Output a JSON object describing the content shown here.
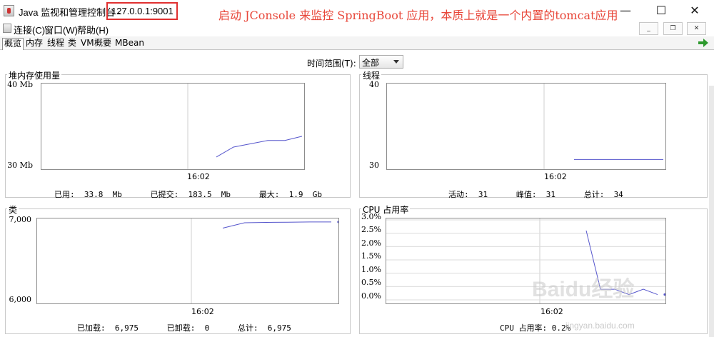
{
  "window": {
    "title": "Java 监视和管理控制台 -",
    "address": "127.0.0.1:9001",
    "annotation": "启动 JConsole 来监控 SpringBoot 应用，本质上就是一个内置的tomcat应用",
    "minimize": "—",
    "maximize": "☐",
    "close": "✕"
  },
  "menu": {
    "items": [
      "连接(C)",
      "窗口(W)",
      "帮助(H)"
    ],
    "mdi_minimize": "_",
    "mdi_restore": "❐",
    "mdi_close": "✕"
  },
  "tabs": [
    "概览",
    "内存",
    "线程",
    "类",
    "VM",
    "概要",
    "MBean"
  ],
  "time_range": {
    "label": "时间范围(T):",
    "selected": "全部"
  },
  "panels": {
    "heap": {
      "title": "堆内存使用量",
      "y_top": "40 Mb",
      "y_bottom": "30 Mb",
      "x_label": "16:02",
      "legend": "已用",
      "legend_value": "33,776,000",
      "summary": "已用:  33.8  Mb      已提交:  183.5  Mb      最大:  1.9  Gb"
    },
    "threads": {
      "title": "线程",
      "y_top": "40",
      "y_bottom": "30",
      "x_label": "16:02",
      "legend": "活动线程",
      "legend_value": "31",
      "summary": "活动:  31      峰值:  31      总计:  34"
    },
    "classes": {
      "title": "类",
      "y_top": "7,000",
      "y_bottom": "6,000",
      "x_label": "16:02",
      "legend": "已加载",
      "legend_value": "6,975",
      "summary": "已加载:  6,975      已卸载:  0      总计:  6,975"
    },
    "cpu": {
      "title": "CPU 占用率",
      "y_ticks": [
        "3.0%",
        "2.5%",
        "2.0%",
        "1.5%",
        "1.0%",
        "0.5%",
        "0.0%"
      ],
      "x_label": "16:02",
      "legend": "CPU 占用率",
      "legend_value": "0.2%",
      "summary": "CPU 占用率: 0.2%"
    }
  },
  "watermark": {
    "brand": "Baidu经验",
    "sub": "jingyan.baidu.com"
  },
  "colors": {
    "series": "#5555cc",
    "annotation": "#e8473a",
    "highlight_border": "#e03030"
  },
  "chart_data": [
    {
      "type": "line",
      "title": "堆内存使用量",
      "ylim": [
        30,
        40
      ],
      "xlabel": "16:02",
      "series": [
        {
          "name": "已用",
          "x": [
            0,
            1,
            2,
            3,
            4,
            5
          ],
          "values": [
            31.3,
            32.5,
            32.9,
            33.3,
            33.3,
            33.8
          ]
        }
      ]
    },
    {
      "type": "line",
      "title": "线程",
      "ylim": [
        30,
        40
      ],
      "xlabel": "16:02",
      "series": [
        {
          "name": "活动线程",
          "x": [
            0,
            1,
            2,
            3,
            4,
            5
          ],
          "values": [
            31,
            31,
            31,
            31,
            31,
            31
          ]
        }
      ]
    },
    {
      "type": "line",
      "title": "类",
      "ylim": [
        6000,
        7000
      ],
      "xlabel": "16:02",
      "series": [
        {
          "name": "已加载",
          "x": [
            0,
            1,
            2,
            3,
            4,
            5
          ],
          "values": [
            6900,
            6965,
            6970,
            6972,
            6975,
            6975
          ]
        }
      ]
    },
    {
      "type": "line",
      "title": "CPU 占用率",
      "ylim": [
        0,
        3
      ],
      "xlabel": "16:02",
      "series": [
        {
          "name": "CPU 占用率",
          "x": [
            0,
            1,
            2,
            3,
            4,
            5
          ],
          "values": [
            2.6,
            0.4,
            0.4,
            0.2,
            0.4,
            0.2
          ]
        }
      ]
    }
  ]
}
